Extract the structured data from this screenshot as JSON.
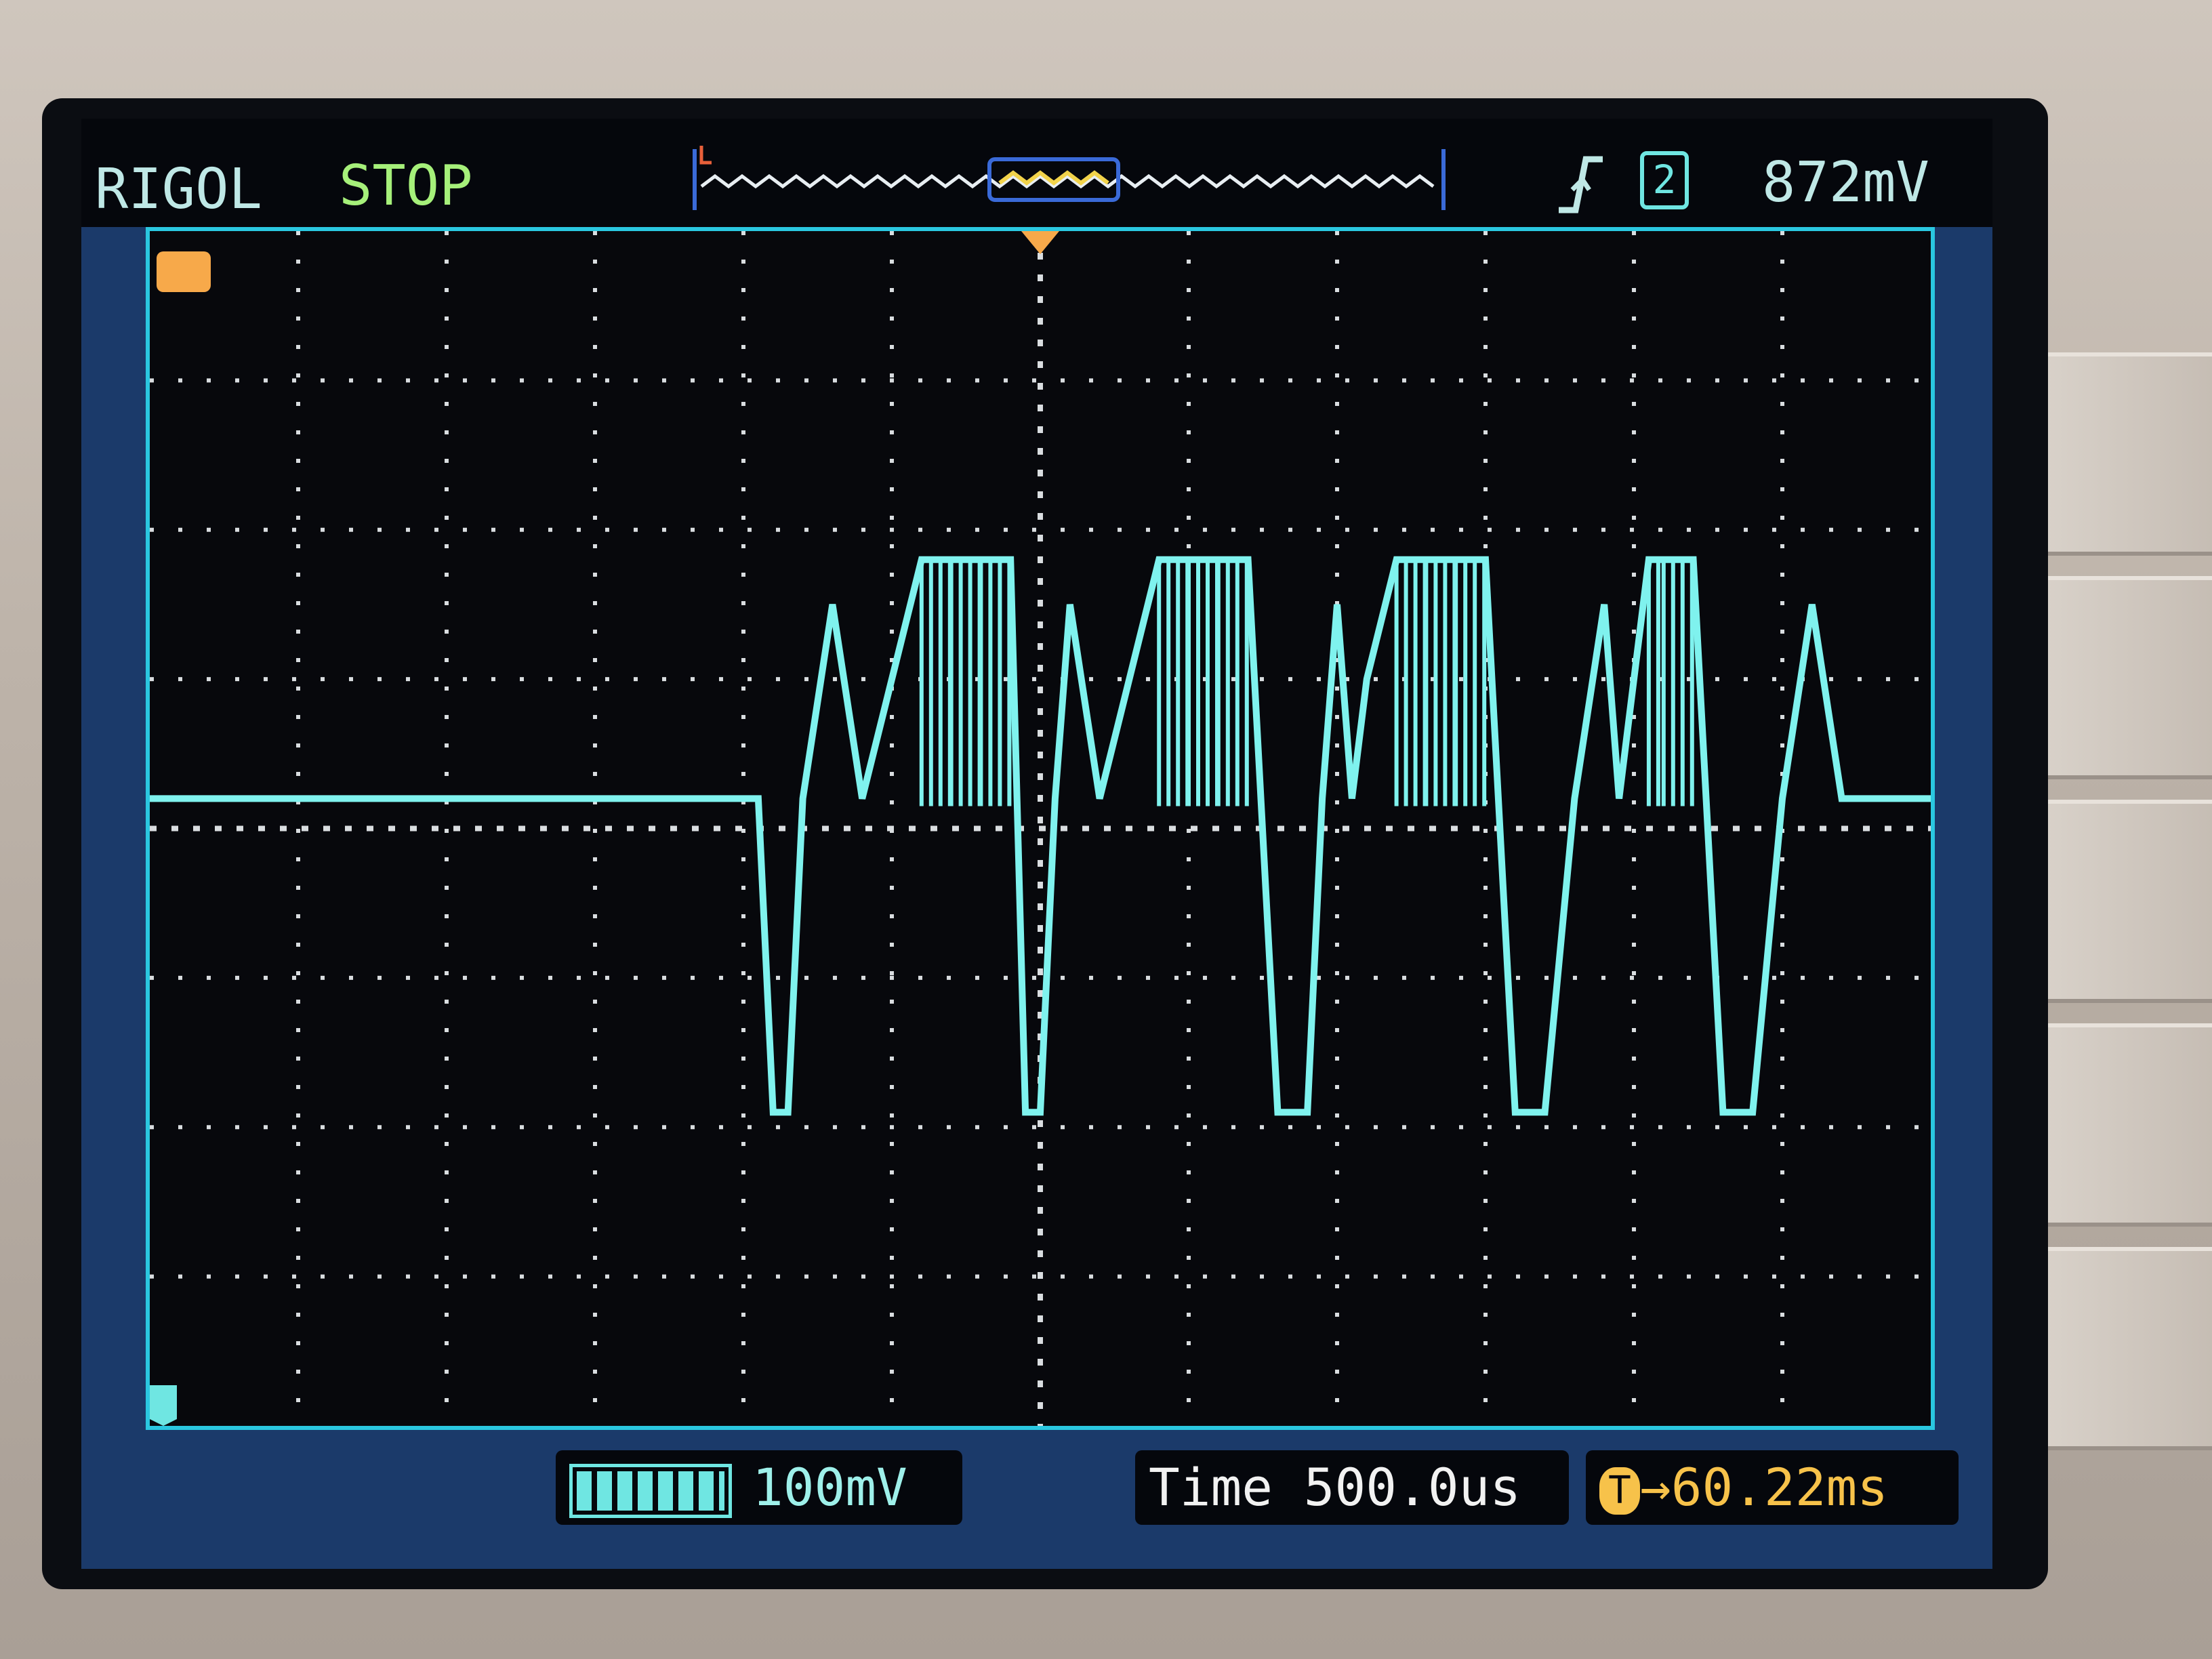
{
  "status": {
    "brand": "RIGOL",
    "run_state": "STOP",
    "trigger_level": "872mV",
    "trigger_channel": "2",
    "trigger_edge_icon": "rising-edge-icon"
  },
  "bottom": {
    "channel_scale": "100mV",
    "time_label": "Time",
    "time_value": "500.0us",
    "trigger_offset": "→60.22ms",
    "trigger_offset_prefix": "T"
  },
  "colors": {
    "trace": "#7ff2ee",
    "grid": "#d9dde0",
    "trigger_marker": "#f7a94a",
    "screen_border": "#2ac7e0",
    "status_text": "#bfe8e6",
    "run_state": "#a6f07a"
  },
  "chart_data": {
    "type": "line",
    "title": "",
    "xlabel": "",
    "ylabel": "",
    "grid": true,
    "x_divisions": 12,
    "y_divisions": 8,
    "series": [
      {
        "x": [
          0,
          4.0,
          4.1,
          4.2,
          4.3,
          4.4,
          4.6,
          4.8,
          5.0,
          5.2,
          5.4,
          5.6,
          5.8,
          5.9,
          6.0,
          6.1,
          6.2,
          6.4,
          6.6,
          6.8,
          7.0,
          7.2,
          7.4,
          7.6,
          7.8,
          7.9,
          8.0,
          8.1,
          8.2,
          8.4,
          8.6,
          8.8,
          9.0,
          9.2,
          9.4,
          9.6,
          9.8,
          9.9,
          10.0,
          10.1,
          10.2,
          10.4,
          10.6,
          10.8,
          11.0,
          11.2,
          11.4,
          11.6,
          11.7,
          11.8,
          11.9,
          12.0
        ],
        "y": [
          0.2,
          0.2,
          0.2,
          -1.9,
          -1.9,
          0.2,
          1.5,
          0.2,
          1.0,
          1.8,
          1.8,
          1.8,
          1.8,
          -1.9,
          -1.9,
          0.2,
          1.5,
          0.2,
          1.0,
          1.8,
          1.8,
          1.8,
          1.8,
          -1.9,
          -1.9,
          0.2,
          1.5,
          0.2,
          1.0,
          1.8,
          1.8,
          1.8,
          1.8,
          -1.9,
          -1.9,
          0.2,
          1.5,
          0.2,
          1.0,
          1.8,
          1.8,
          1.8,
          -1.9,
          -1.9,
          0.2,
          1.5,
          0.2,
          0.2,
          0.2,
          0.2,
          0.2,
          0.2
        ]
      }
    ]
  }
}
